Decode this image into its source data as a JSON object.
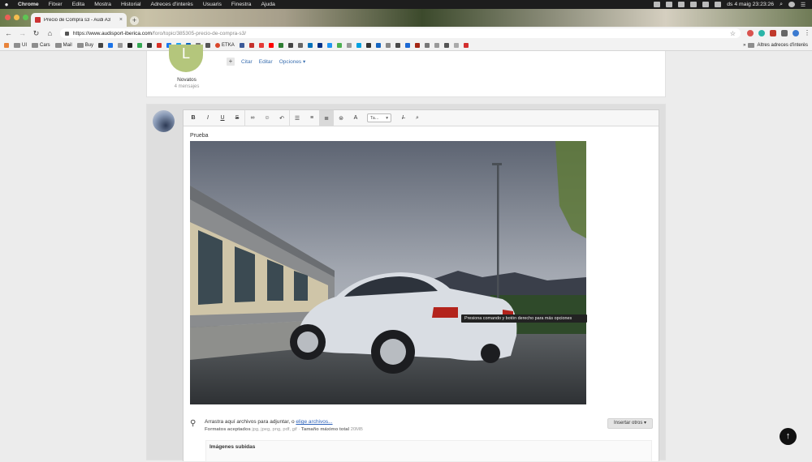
{
  "menubar": {
    "app": "Chrome",
    "items": [
      "Fitxer",
      "Edita",
      "Mostra",
      "Historial",
      "Adreces d'interès",
      "Usuaris",
      "Finestra",
      "Ajuda"
    ],
    "clock": "ds 4 maig  23:23:26"
  },
  "tab": {
    "title": "Precio de Compra s3 - Audi A3",
    "close": "×"
  },
  "toolbar": {
    "url_host": "https://www.audisport-iberica.com",
    "url_path": "/foro/topic/385305-precio-de-compra-s3/"
  },
  "bookmarks": {
    "items": [
      "UI",
      "Cars",
      "Mail",
      "Buy",
      "ETKA"
    ],
    "other": "Altres adreces d'interès"
  },
  "post": {
    "avatar_letter": "L",
    "rank": "Novatos",
    "messages": "4 mensajes",
    "plus": "+",
    "quote": "Citar",
    "edit": "Editar",
    "options": "Opciones ▾"
  },
  "editor": {
    "font_select": "Ta...",
    "body_text": "Prueba",
    "tooltip": "Presiona comando y botón derecho para más opciones"
  },
  "attach": {
    "drag_text": "Arrastra aquí archivos para adjuntar, o ",
    "choose_link": "elige archivos...",
    "formats_label": "Formatos aceptados",
    "formats": "jpg, jpeg, png, pdf, gif",
    "max_label": "Tamaño máximo total",
    "max_size": "20MB",
    "insert_button": "Insertar otros ▾",
    "uploaded_title": "Imágenes subidas"
  },
  "scroll_top_icon": "arrow-up-icon"
}
